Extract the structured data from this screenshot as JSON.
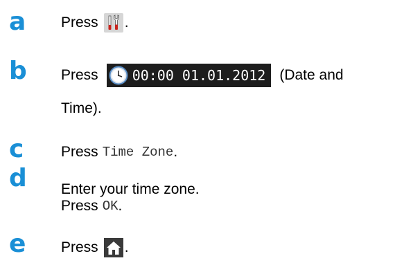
{
  "steps": [
    {
      "letter": "a"
    },
    {
      "letter": "b"
    },
    {
      "letter": "c"
    },
    {
      "letter": "d"
    },
    {
      "letter": "e"
    }
  ],
  "step_a": {
    "press": "Press",
    "end": "."
  },
  "step_b": {
    "press": "Press",
    "datetime_label": "00:00 01.01.2012",
    "after": "(Date and",
    "cont": "Time)."
  },
  "step_c": {
    "press": "Press",
    "button": "Time Zone",
    "end": "."
  },
  "step_d": {
    "line1": "Enter your time zone.",
    "press": "Press",
    "button": "OK",
    "end": "."
  },
  "step_e": {
    "press": "Press",
    "end": "."
  },
  "icons": {
    "settings": "tools-icon",
    "datetime": "clock-icon",
    "home": "home-icon"
  }
}
